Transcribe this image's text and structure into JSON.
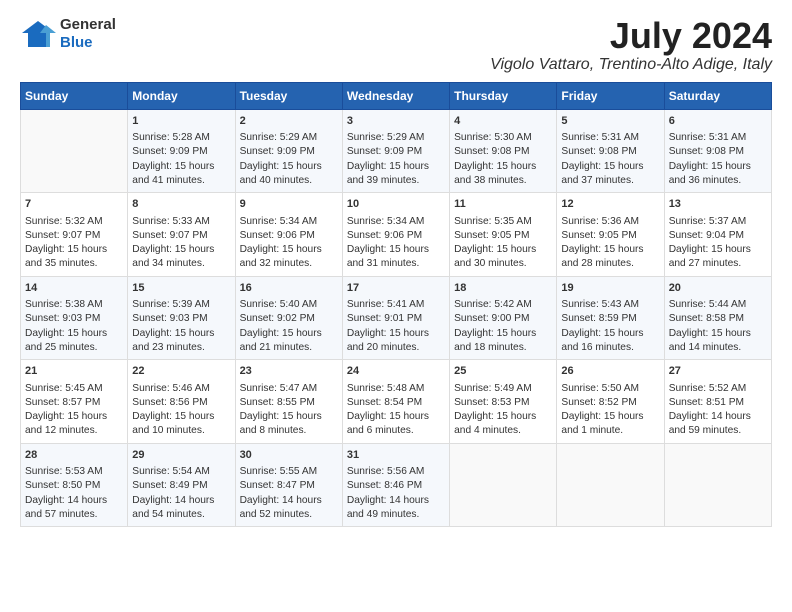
{
  "header": {
    "logo_line1": "General",
    "logo_line2": "Blue",
    "month": "July 2024",
    "location": "Vigolo Vattaro, Trentino-Alto Adige, Italy"
  },
  "days_of_week": [
    "Sunday",
    "Monday",
    "Tuesday",
    "Wednesday",
    "Thursday",
    "Friday",
    "Saturday"
  ],
  "weeks": [
    [
      {
        "day": "",
        "content": ""
      },
      {
        "day": "1",
        "content": "Sunrise: 5:28 AM\nSunset: 9:09 PM\nDaylight: 15 hours\nand 41 minutes."
      },
      {
        "day": "2",
        "content": "Sunrise: 5:29 AM\nSunset: 9:09 PM\nDaylight: 15 hours\nand 40 minutes."
      },
      {
        "day": "3",
        "content": "Sunrise: 5:29 AM\nSunset: 9:09 PM\nDaylight: 15 hours\nand 39 minutes."
      },
      {
        "day": "4",
        "content": "Sunrise: 5:30 AM\nSunset: 9:08 PM\nDaylight: 15 hours\nand 38 minutes."
      },
      {
        "day": "5",
        "content": "Sunrise: 5:31 AM\nSunset: 9:08 PM\nDaylight: 15 hours\nand 37 minutes."
      },
      {
        "day": "6",
        "content": "Sunrise: 5:31 AM\nSunset: 9:08 PM\nDaylight: 15 hours\nand 36 minutes."
      }
    ],
    [
      {
        "day": "7",
        "content": "Sunrise: 5:32 AM\nSunset: 9:07 PM\nDaylight: 15 hours\nand 35 minutes."
      },
      {
        "day": "8",
        "content": "Sunrise: 5:33 AM\nSunset: 9:07 PM\nDaylight: 15 hours\nand 34 minutes."
      },
      {
        "day": "9",
        "content": "Sunrise: 5:34 AM\nSunset: 9:06 PM\nDaylight: 15 hours\nand 32 minutes."
      },
      {
        "day": "10",
        "content": "Sunrise: 5:34 AM\nSunset: 9:06 PM\nDaylight: 15 hours\nand 31 minutes."
      },
      {
        "day": "11",
        "content": "Sunrise: 5:35 AM\nSunset: 9:05 PM\nDaylight: 15 hours\nand 30 minutes."
      },
      {
        "day": "12",
        "content": "Sunrise: 5:36 AM\nSunset: 9:05 PM\nDaylight: 15 hours\nand 28 minutes."
      },
      {
        "day": "13",
        "content": "Sunrise: 5:37 AM\nSunset: 9:04 PM\nDaylight: 15 hours\nand 27 minutes."
      }
    ],
    [
      {
        "day": "14",
        "content": "Sunrise: 5:38 AM\nSunset: 9:03 PM\nDaylight: 15 hours\nand 25 minutes."
      },
      {
        "day": "15",
        "content": "Sunrise: 5:39 AM\nSunset: 9:03 PM\nDaylight: 15 hours\nand 23 minutes."
      },
      {
        "day": "16",
        "content": "Sunrise: 5:40 AM\nSunset: 9:02 PM\nDaylight: 15 hours\nand 21 minutes."
      },
      {
        "day": "17",
        "content": "Sunrise: 5:41 AM\nSunset: 9:01 PM\nDaylight: 15 hours\nand 20 minutes."
      },
      {
        "day": "18",
        "content": "Sunrise: 5:42 AM\nSunset: 9:00 PM\nDaylight: 15 hours\nand 18 minutes."
      },
      {
        "day": "19",
        "content": "Sunrise: 5:43 AM\nSunset: 8:59 PM\nDaylight: 15 hours\nand 16 minutes."
      },
      {
        "day": "20",
        "content": "Sunrise: 5:44 AM\nSunset: 8:58 PM\nDaylight: 15 hours\nand 14 minutes."
      }
    ],
    [
      {
        "day": "21",
        "content": "Sunrise: 5:45 AM\nSunset: 8:57 PM\nDaylight: 15 hours\nand 12 minutes."
      },
      {
        "day": "22",
        "content": "Sunrise: 5:46 AM\nSunset: 8:56 PM\nDaylight: 15 hours\nand 10 minutes."
      },
      {
        "day": "23",
        "content": "Sunrise: 5:47 AM\nSunset: 8:55 PM\nDaylight: 15 hours\nand 8 minutes."
      },
      {
        "day": "24",
        "content": "Sunrise: 5:48 AM\nSunset: 8:54 PM\nDaylight: 15 hours\nand 6 minutes."
      },
      {
        "day": "25",
        "content": "Sunrise: 5:49 AM\nSunset: 8:53 PM\nDaylight: 15 hours\nand 4 minutes."
      },
      {
        "day": "26",
        "content": "Sunrise: 5:50 AM\nSunset: 8:52 PM\nDaylight: 15 hours\nand 1 minute."
      },
      {
        "day": "27",
        "content": "Sunrise: 5:52 AM\nSunset: 8:51 PM\nDaylight: 14 hours\nand 59 minutes."
      }
    ],
    [
      {
        "day": "28",
        "content": "Sunrise: 5:53 AM\nSunset: 8:50 PM\nDaylight: 14 hours\nand 57 minutes."
      },
      {
        "day": "29",
        "content": "Sunrise: 5:54 AM\nSunset: 8:49 PM\nDaylight: 14 hours\nand 54 minutes."
      },
      {
        "day": "30",
        "content": "Sunrise: 5:55 AM\nSunset: 8:47 PM\nDaylight: 14 hours\nand 52 minutes."
      },
      {
        "day": "31",
        "content": "Sunrise: 5:56 AM\nSunset: 8:46 PM\nDaylight: 14 hours\nand 49 minutes."
      },
      {
        "day": "",
        "content": ""
      },
      {
        "day": "",
        "content": ""
      },
      {
        "day": "",
        "content": ""
      }
    ]
  ]
}
